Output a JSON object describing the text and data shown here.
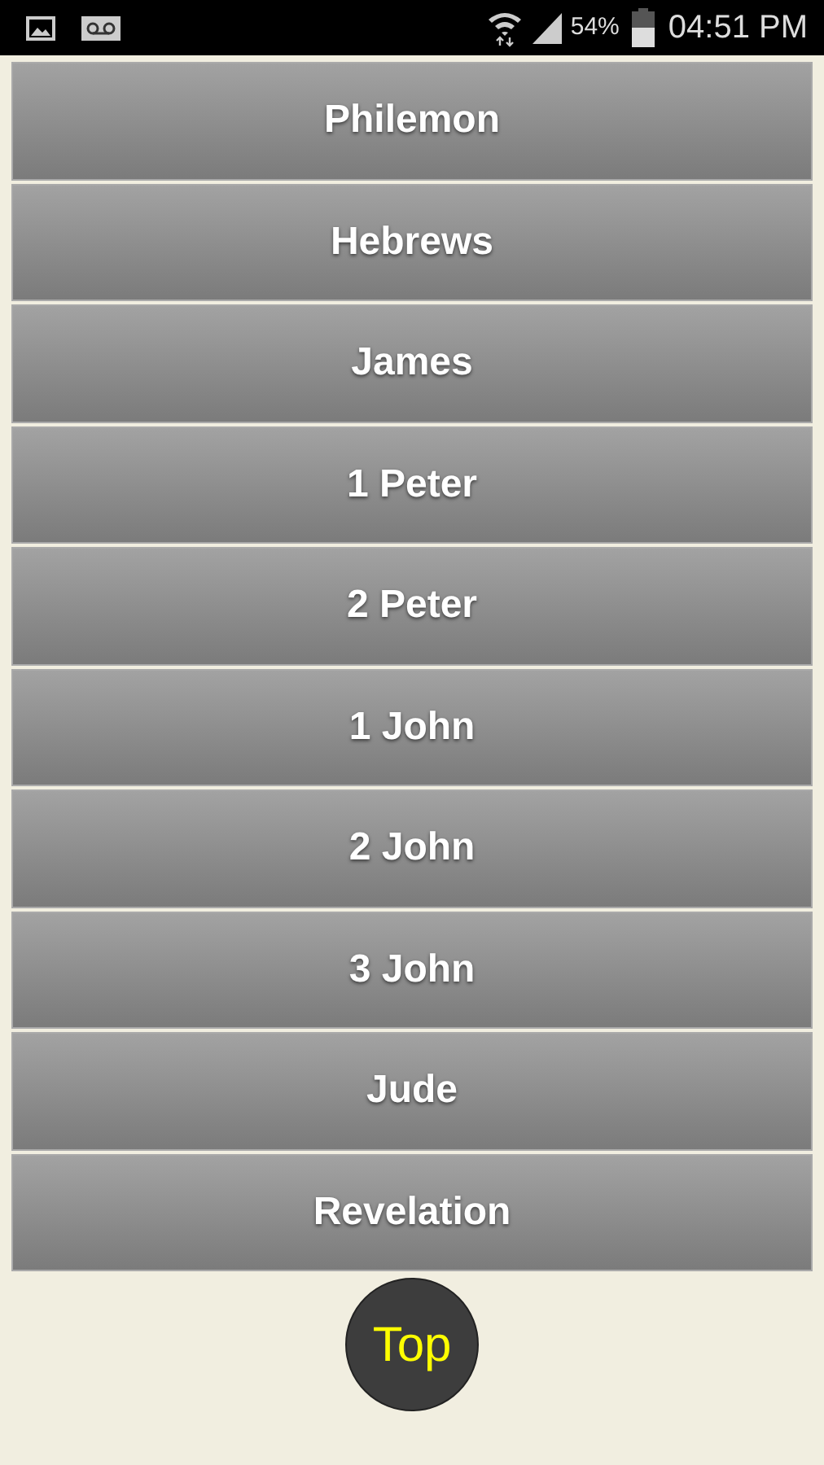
{
  "status_bar": {
    "battery": "54%",
    "time": "04:51 PM"
  },
  "books": [
    "Philemon",
    "Hebrews",
    "James",
    "1 Peter",
    "2 Peter",
    "1 John",
    "2 John",
    "3 John",
    "Jude",
    "Revelation"
  ],
  "top_button": "Top"
}
